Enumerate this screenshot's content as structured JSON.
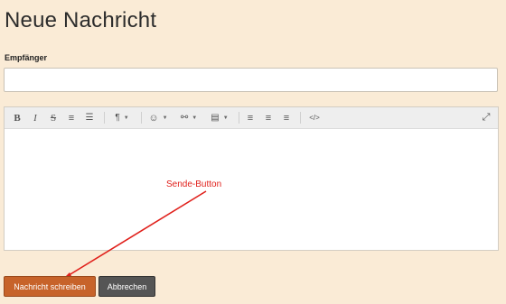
{
  "page": {
    "title": "Neue Nachricht"
  },
  "form": {
    "recipient_label": "Empfänger",
    "recipient_value": ""
  },
  "toolbar": {
    "items": [
      {
        "name": "bold-icon",
        "glyph": "B"
      },
      {
        "name": "italic-icon",
        "glyph": "I"
      },
      {
        "name": "strikethrough-icon",
        "glyph": "S"
      },
      {
        "name": "ordered-list-icon",
        "glyph": "≡"
      },
      {
        "name": "unordered-list-icon",
        "glyph": "☰"
      },
      {
        "name": "paragraph-icon",
        "glyph": "¶"
      },
      {
        "name": "emoji-icon",
        "glyph": "☺"
      },
      {
        "name": "link-icon",
        "glyph": "⚯"
      },
      {
        "name": "file-icon",
        "glyph": "▤"
      },
      {
        "name": "align-left-icon",
        "glyph": "≡"
      },
      {
        "name": "align-center-icon",
        "glyph": "≡"
      },
      {
        "name": "align-right-icon",
        "glyph": "≡"
      },
      {
        "name": "code-icon",
        "glyph": "</>"
      },
      {
        "name": "fullscreen-icon",
        "glyph": "⤢"
      }
    ],
    "caret": "▼"
  },
  "annotation": {
    "text": "Sende-Button",
    "color": "#e0201b"
  },
  "buttons": {
    "send_label": "Nachricht schreiben",
    "cancel_label": "Abbrechen"
  },
  "colors": {
    "background": "#faebd6",
    "send_button": "#c7632a",
    "cancel_button": "#555555"
  }
}
